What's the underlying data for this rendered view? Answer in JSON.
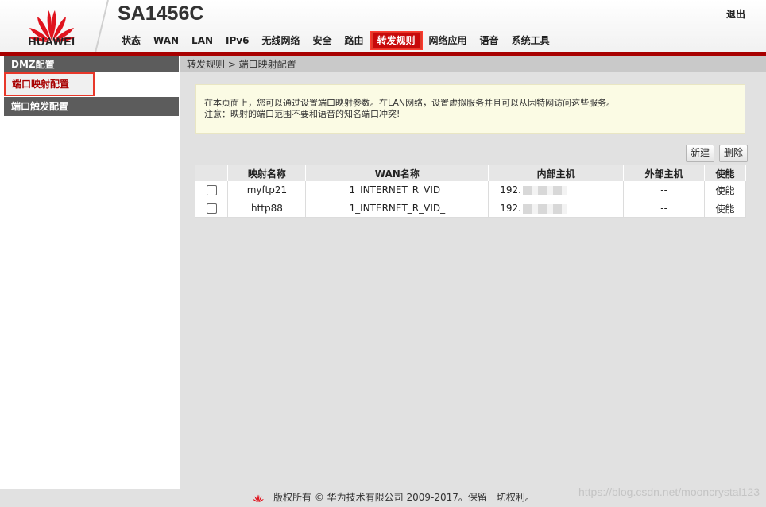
{
  "header": {
    "logo_text": "HUAWEI",
    "model": "SA1456C",
    "logout": "退出",
    "nav": [
      {
        "label": "状态"
      },
      {
        "label": "WAN"
      },
      {
        "label": "LAN"
      },
      {
        "label": "IPv6"
      },
      {
        "label": "无线网络"
      },
      {
        "label": "安全"
      },
      {
        "label": "路由"
      },
      {
        "label": "转发规则",
        "active": true
      },
      {
        "label": "网络应用"
      },
      {
        "label": "语音"
      },
      {
        "label": "系统工具"
      }
    ]
  },
  "sidebar": {
    "group1": "DMZ配置",
    "active_item": "端口映射配置",
    "group2": "端口触发配置"
  },
  "main": {
    "breadcrumb": "转发规则 > 端口映射配置",
    "notice_line1": "在本页面上，您可以通过设置端口映射参数。在LAN网络，设置虚拟服务并且可以从因特网访问这些服务。",
    "notice_line2": "注意：映射的端口范围不要和语音的知名端口冲突!",
    "new_button": "新建",
    "delete_button": "删除",
    "table": {
      "headers": [
        "映射名称",
        "WAN名称",
        "内部主机",
        "外部主机",
        "使能"
      ],
      "rows": [
        {
          "name": "myftp21",
          "wan": "1_INTERNET_R_VID_",
          "internal": "192.",
          "external": "--",
          "enable": "使能"
        },
        {
          "name": "http88",
          "wan": "1_INTERNET_R_VID_",
          "internal": "192.",
          "external": "--",
          "enable": "使能"
        }
      ]
    }
  },
  "footer": {
    "copyright": "版权所有 © 华为技术有限公司 2009-2017。保留一切权利。",
    "watermark": "https://blog.csdn.net/mooncrystal123"
  },
  "colors": {
    "brand_red": "#c8090a",
    "header_bar": "#a80000",
    "sidebar_group": "#5c5c5c",
    "content_bg": "#e1e1e1",
    "notice_bg": "#fbfbe4"
  }
}
